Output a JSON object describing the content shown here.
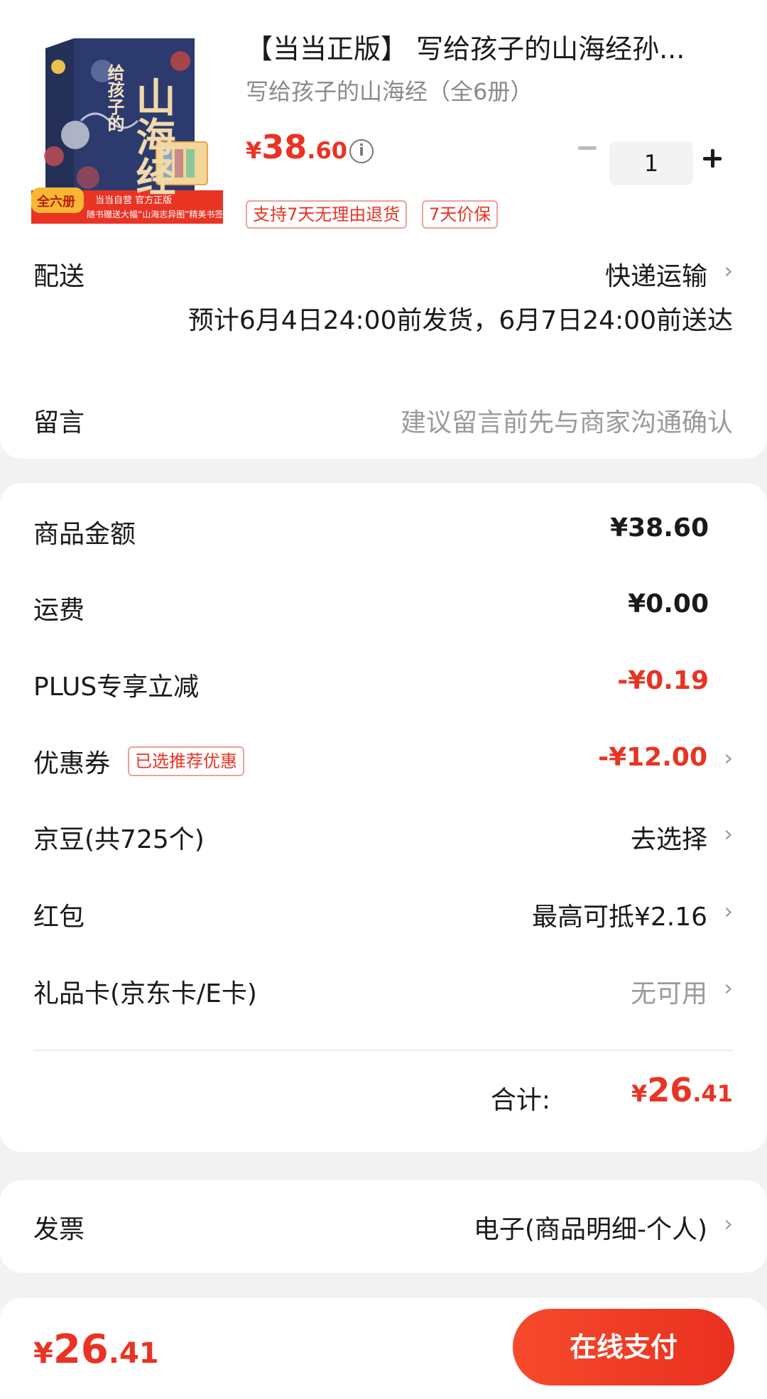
{
  "product": {
    "title": "【当当正版】 写给孩子的山海经孙...",
    "subtitle": "写给孩子的山海经（全6册）",
    "price": {
      "currency": "¥",
      "integer": "38",
      "decimal": ".60"
    },
    "quantity": "1",
    "tags": [
      "支持7天无理由退货",
      "7天价保"
    ],
    "cover": {
      "big_title": "山海经",
      "small_title": "给孩子的",
      "badge": "全六册",
      "banner_line1": "当当自营 官方正版",
      "banner_line2": "随书赠送大幅“山海志异图”精美书签"
    }
  },
  "delivery": {
    "label": "配送",
    "method": "快递运输",
    "eta": "预计6月4日24:00前发货，6月7日24:00前送达"
  },
  "remark": {
    "label": "留言",
    "placeholder": "建议留言前先与商家沟通确认"
  },
  "summary": {
    "goods_label": "商品金额",
    "goods_value": "¥38.60",
    "shipping_label": "运费",
    "shipping_value": "¥0.00",
    "plus_label": "PLUS专享立减",
    "plus_value": "-¥0.19",
    "coupon_label": "优惠券",
    "coupon_badge": "已选推荐优惠",
    "coupon_value": "-¥12.00",
    "jingdou_label": "京豆(共725个)",
    "jingdou_value": "去选择",
    "redpacket_label": "红包",
    "redpacket_value": "最高可抵¥2.16",
    "giftcard_label": "礼品卡(京东卡/E卡)",
    "giftcard_value": "无可用",
    "total_label": "合计:",
    "total": {
      "currency": "¥",
      "integer": "26",
      "decimal": ".41"
    }
  },
  "invoice": {
    "label": "发票",
    "value": "电子(商品明细-个人)"
  },
  "footer": {
    "price": {
      "currency": "¥",
      "integer": "26",
      "decimal": ".41"
    },
    "pay_label": "在线支付"
  },
  "colors": {
    "accent": "#e93323",
    "background": "#f2f2f2",
    "card": "#ffffff"
  }
}
